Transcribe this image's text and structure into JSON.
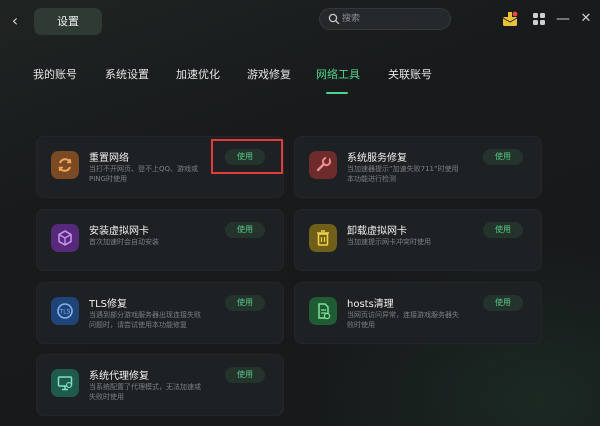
{
  "header": {
    "back_glyph": "‹",
    "title": "设置",
    "search_placeholder": "搜索",
    "minimize_glyph": "—",
    "close_glyph": "✕"
  },
  "tabs": [
    {
      "label": "我的账号",
      "active": false
    },
    {
      "label": "系统设置",
      "active": false
    },
    {
      "label": "加速优化",
      "active": false
    },
    {
      "label": "游戏修复",
      "active": false
    },
    {
      "label": "网络工具",
      "active": true
    },
    {
      "label": "关联账号",
      "active": false
    }
  ],
  "tools": [
    {
      "name": "重置网络",
      "desc": "当打不开网页、登不上QQ、游戏或PING时使用",
      "button": "使用",
      "icon": "refresh-icon",
      "color": "#a7622d"
    },
    {
      "name": "系统服务修复",
      "desc": "当加速器提示“加速失败711”时使用本功能进行检测",
      "button": "使用",
      "icon": "wrench-icon",
      "color": "#9a3b3b"
    },
    {
      "name": "安装虚拟网卡",
      "desc": "首次加速时会自动安装",
      "button": "使用",
      "icon": "cube-icon",
      "color": "#7a3ea8"
    },
    {
      "name": "卸载虚拟网卡",
      "desc": "当加速提示网卡冲突时使用",
      "button": "使用",
      "icon": "trash-icon",
      "color": "#a08a22"
    },
    {
      "name": "TLS修复",
      "desc": "当遇到部分游戏服务器出现连接失败问题时，请尝试使用本功能修复",
      "button": "使用",
      "icon": "tls-icon",
      "color": "#2a5fa8"
    },
    {
      "name": "hosts清理",
      "desc": "当网页访问异常，连接游戏服务器失败时使用",
      "button": "使用",
      "icon": "file-icon",
      "color": "#2f8a4a"
    },
    {
      "name": "系统代理修复",
      "desc": "当系统配置了代理模式，无法加速或失败时使用",
      "button": "使用",
      "icon": "monitor-icon",
      "color": "#2f7a68"
    }
  ],
  "colors": {
    "accent": "#4fd28a",
    "highlight": "#e43a3a"
  }
}
